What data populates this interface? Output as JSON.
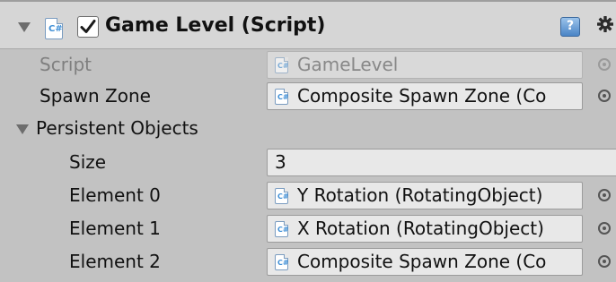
{
  "component": {
    "title": "Game Level (Script)",
    "enabled": true
  },
  "properties": {
    "script": {
      "label": "Script",
      "value": "GameLevel"
    },
    "spawn_zone": {
      "label": "Spawn Zone",
      "value": "Composite Spawn Zone (Co"
    },
    "persistent_objects": {
      "label": "Persistent Objects",
      "size_label": "Size",
      "size_value": "3",
      "elements": [
        {
          "label": "Element 0",
          "value": "Y Rotation (RotatingObject)"
        },
        {
          "label": "Element 1",
          "value": "X Rotation (RotatingObject)"
        },
        {
          "label": "Element 2",
          "value": "Composite Spawn Zone (Co"
        }
      ]
    }
  },
  "icons": {
    "help": "?",
    "colors": {
      "header_bg": "#d6d6d6",
      "panel_bg": "#c2c2c2",
      "field_bg": "#e8e8e8",
      "script_icon_blue": "#3f8fd6",
      "help_icon_blue": "#4a84c6"
    }
  }
}
